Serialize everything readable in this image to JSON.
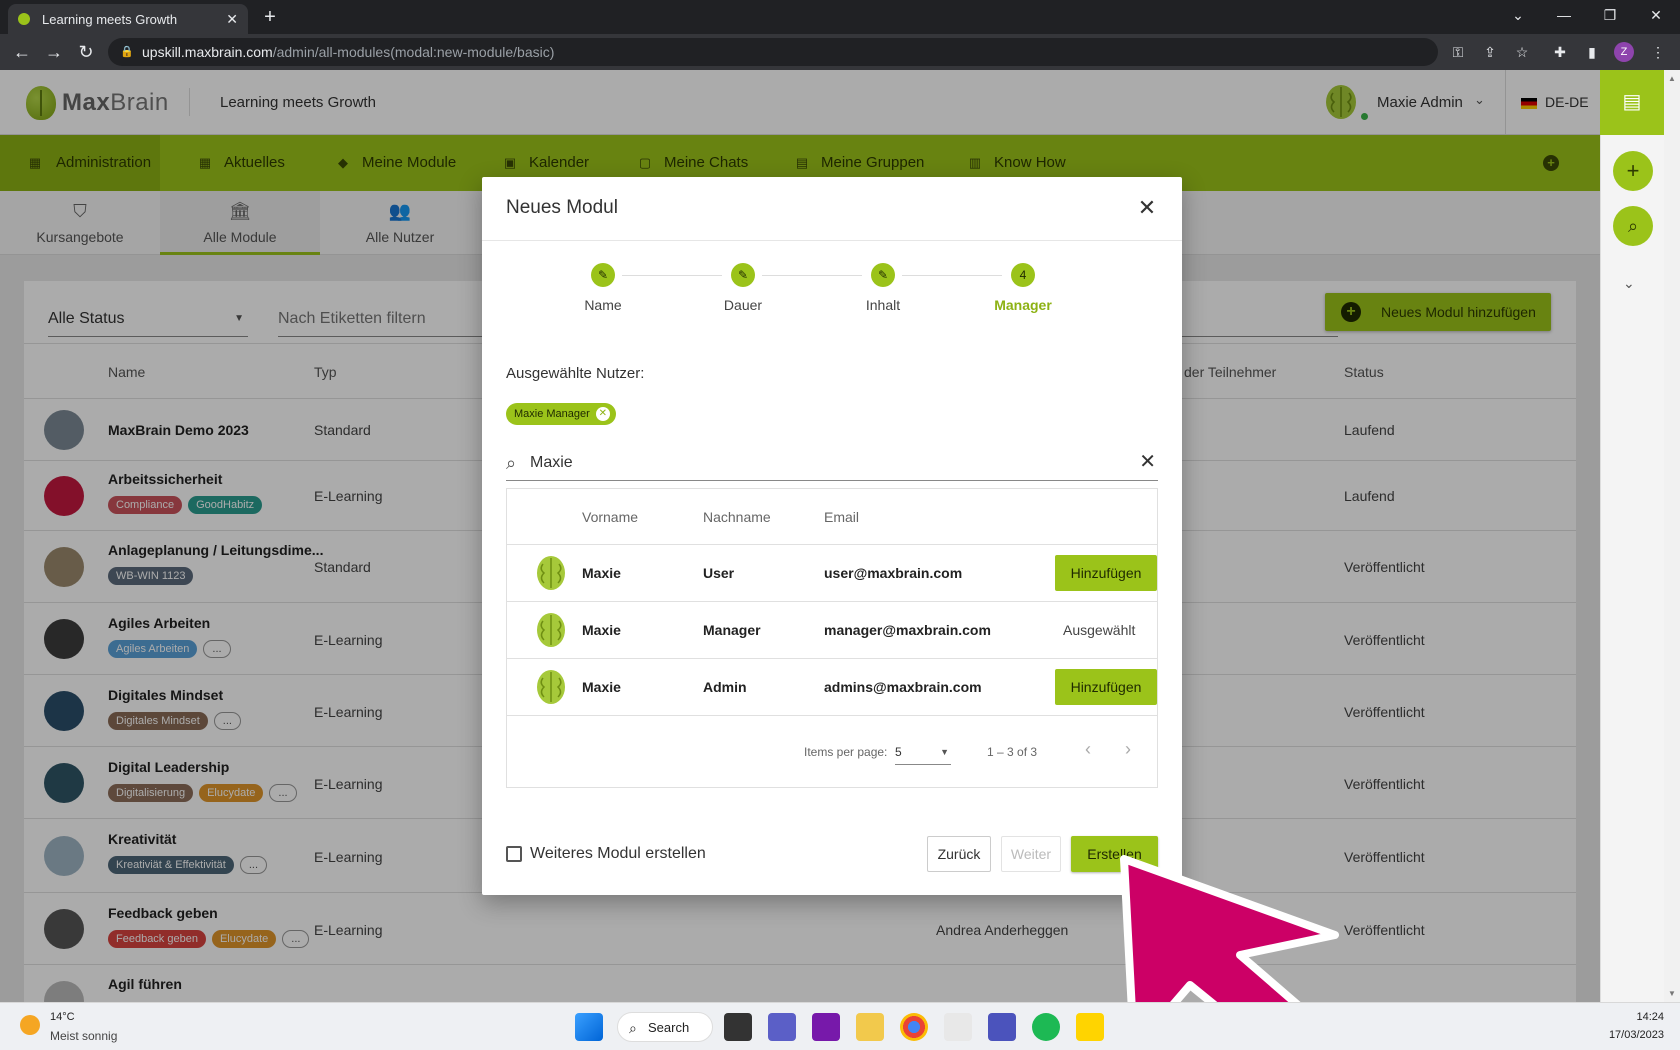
{
  "browser": {
    "tab_title": "Learning meets Growth",
    "url_host": "upskill.maxbrain.com",
    "url_path": "/admin/all-modules(modal:new-module/basic)",
    "profile_initial": "Z"
  },
  "header": {
    "logo_bold": "Max",
    "logo_rest": "Brain",
    "tagline": "Learning meets Growth",
    "user_name": "Maxie Admin",
    "language": "DE-DE"
  },
  "mainnav": {
    "items": [
      {
        "label": "Administration",
        "icon": "admin-icon"
      },
      {
        "label": "Aktuelles",
        "icon": "news-icon"
      },
      {
        "label": "Meine Module",
        "icon": "graduation-cap-icon"
      },
      {
        "label": "Kalender",
        "icon": "calendar-icon"
      },
      {
        "label": "Meine Chats",
        "icon": "chat-icon"
      },
      {
        "label": "Meine Gruppen",
        "icon": "groups-icon"
      },
      {
        "label": "Know How",
        "icon": "book-icon"
      }
    ]
  },
  "subnav": {
    "items": [
      {
        "label": "Kursangebote",
        "icon": "course-offer-icon"
      },
      {
        "label": "Alle Module",
        "icon": "bank-icon"
      },
      {
        "label": "Alle Nutzer",
        "icon": "users-icon"
      }
    ]
  },
  "content": {
    "status_filter": "Alle Status",
    "tag_filter_placeholder": "Nach Etiketten filtern",
    "add_module_label": "Neues Modul hinzufügen",
    "columns": {
      "name": "Name",
      "type": "Typ",
      "participants": "der Teilnehmer",
      "status": "Status"
    },
    "rows": [
      {
        "name": "MaxBrain Demo 2023",
        "type": "Standard",
        "status": "Laufend",
        "manager": "",
        "tags": []
      },
      {
        "name": "Arbeitssicherheit",
        "type": "E-Learning",
        "status": "Laufend",
        "manager": "",
        "tags": [
          {
            "label": "Compliance",
            "color": "#c9535b"
          },
          {
            "label": "GoodHabitz",
            "color": "#2a9d8f"
          }
        ]
      },
      {
        "name": "Anlageplanung / Leitungsdime...",
        "type": "Standard",
        "status": "Veröffentlicht",
        "manager": "",
        "tags": [
          {
            "label": "WB-WIN 1123",
            "color": "#5b6b7c"
          }
        ]
      },
      {
        "name": "Agiles Arbeiten",
        "type": "E-Learning",
        "status": "Veröffentlicht",
        "manager": "",
        "tags": [
          {
            "label": "Agiles Arbeiten",
            "color": "#5aa1d8"
          }
        ],
        "more": "..."
      },
      {
        "name": "Digitales Mindset",
        "type": "E-Learning",
        "status": "Veröffentlicht",
        "manager": "",
        "tags": [
          {
            "label": "Digitales Mindset",
            "color": "#8a6a55"
          }
        ],
        "more": "..."
      },
      {
        "name": "Digital Leadership",
        "type": "E-Learning",
        "status": "Veröffentlicht",
        "manager": "",
        "tags": [
          {
            "label": "Digitalisierung",
            "color": "#8c6d5a"
          },
          {
            "label": "Elucydate",
            "color": "#e0952a"
          }
        ],
        "more": "..."
      },
      {
        "name": "Kreativität",
        "type": "E-Learning",
        "status": "Veröffentlicht",
        "manager": "",
        "tags": [
          {
            "label": "Kreativiät & Effektivität",
            "color": "#4d6678"
          }
        ],
        "more": "..."
      },
      {
        "name": "Feedback geben",
        "type": "E-Learning",
        "status": "Veröffentlicht",
        "manager": "Andrea Anderheggen",
        "tags": [
          {
            "label": "Feedback geben",
            "color": "#d9433f"
          },
          {
            "label": "Elucydate",
            "color": "#e0952a"
          }
        ],
        "more": "..."
      },
      {
        "name": "Agil führen",
        "type": "",
        "status": "",
        "manager": "",
        "tags": []
      }
    ]
  },
  "modal": {
    "title": "Neues Modul",
    "steps": [
      {
        "label": "Name",
        "mark": "✎"
      },
      {
        "label": "Dauer",
        "mark": "✎"
      },
      {
        "label": "Inhalt",
        "mark": "✎"
      },
      {
        "label": "Manager",
        "mark": "4"
      }
    ],
    "selected_label": "Ausgewählte Nutzer:",
    "selected_chip": "Maxie Manager",
    "search_value": "Maxie",
    "table_headers": {
      "first": "Vorname",
      "last": "Nachname",
      "email": "Email"
    },
    "users": [
      {
        "first": "Maxie",
        "last": "User",
        "email": "user@maxbrain.com",
        "action": "Hinzufügen",
        "selected": false
      },
      {
        "first": "Maxie",
        "last": "Manager",
        "email": "manager@maxbrain.com",
        "action": "Ausgewählt",
        "selected": true
      },
      {
        "first": "Maxie",
        "last": "Admin",
        "email": "admins@maxbrain.com",
        "action": "Hinzufügen",
        "selected": false
      }
    ],
    "items_per_page_label": "Items per page:",
    "items_per_page": "5",
    "range": "1 – 3 of 3",
    "more_module_label": "Weiteres Modul erstellen",
    "back_label": "Zurück",
    "next_label": "Weiter",
    "create_label": "Erstellen"
  },
  "taskbar": {
    "temperature": "14°C",
    "weather": "Meist sonnig",
    "search_label": "Search",
    "time": "14:24",
    "date": "17/03/2023"
  },
  "colors": {
    "brand_green": "#9bc31a",
    "cursor_magenta": "#cc0066"
  }
}
